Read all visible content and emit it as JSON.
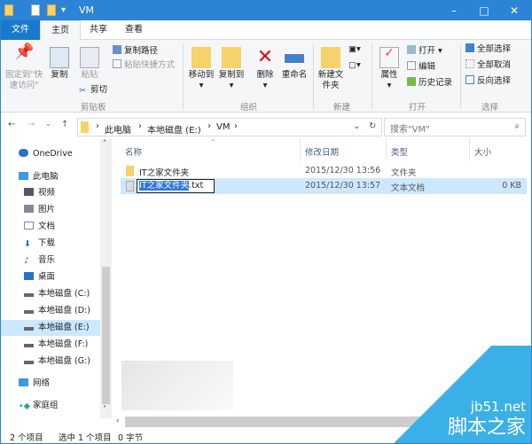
{
  "window": {
    "title": "VM",
    "minimize": "–",
    "maximize": "□",
    "close": "✕"
  },
  "tabs": {
    "file": "文件",
    "home": "主页",
    "share": "共享",
    "view": "查看"
  },
  "ribbon": {
    "pin": "固定到\"快速访问\"",
    "copy": "复制",
    "paste": "粘贴",
    "copy_path": "复制路径",
    "paste_shortcut": "粘贴快捷方式",
    "cut": "剪切",
    "clipboard": "剪贴板",
    "move_to": "移动到",
    "copy_to": "复制到",
    "delete": "删除",
    "rename": "重命名",
    "organize": "组织",
    "new_folder": "新建文件夹",
    "new": "新建",
    "properties": "属性",
    "open": "打开",
    "edit": "编辑",
    "history": "历史记录",
    "open_group": "打开",
    "select_all": "全部选择",
    "select_none": "全部取消",
    "invert": "反向选择",
    "select": "选择"
  },
  "address": {
    "crumbs": [
      "此电脑",
      "本地磁盘 (E:)",
      "VM"
    ],
    "search_placeholder": "搜索\"VM\""
  },
  "sidebar": [
    "OneDrive",
    "此电脑",
    "视频",
    "图片",
    "文档",
    "下载",
    "音乐",
    "桌面",
    "本地磁盘 (C:)",
    "本地磁盘 (D:)",
    "本地磁盘 (E:)",
    "本地磁盘 (F:)",
    "本地磁盘 (G:)",
    "网络",
    "家庭组"
  ],
  "columns": {
    "name": "名称",
    "date": "修改日期",
    "type": "类型",
    "size": "大小"
  },
  "files": [
    {
      "name": "IT之家文件夹",
      "date": "2015/12/30 13:56",
      "type": "文件夹",
      "size": ""
    },
    {
      "name_selected": "IT之家文件夹",
      "name_ext": ".txt",
      "date": "2015/12/30 13:57",
      "type": "文本文档",
      "size": "0 KB"
    }
  ],
  "status": {
    "count": "2 个项目",
    "selected": "选中 1 个项目",
    "size": "0 字节"
  },
  "watermark": {
    "site": "jb51.net",
    "name": "脚本之家"
  }
}
